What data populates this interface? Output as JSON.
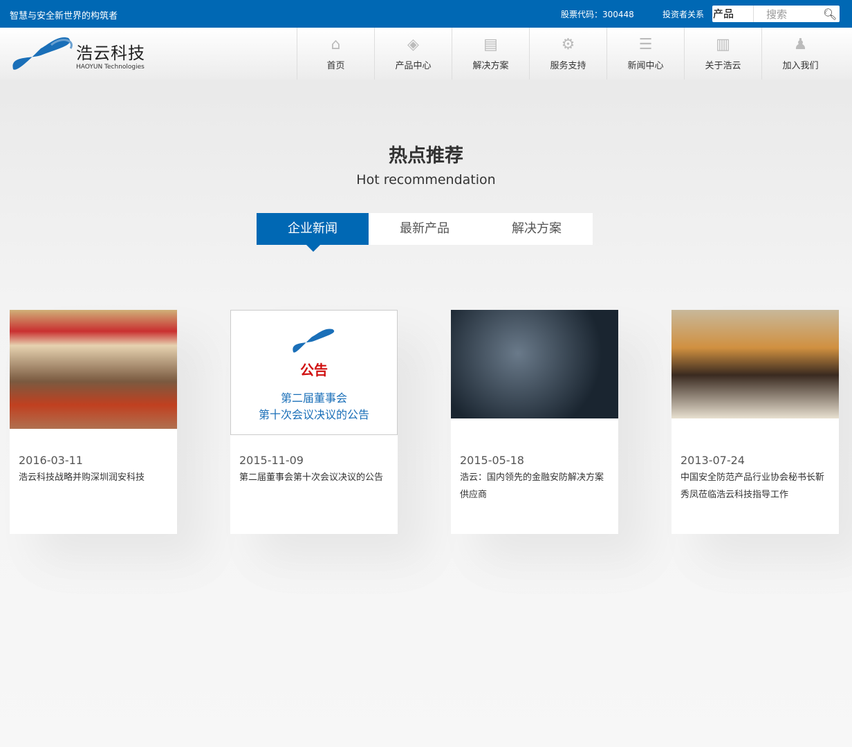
{
  "topbar": {
    "slogan": "智慧与安全新世界的构筑者",
    "stock": "股票代码：300448",
    "investor": "投资者关系",
    "search_category": "产品",
    "search_placeholder": "搜索"
  },
  "logo": {
    "cn": "浩云科技",
    "en": "HAOYUN Technologies"
  },
  "nav": [
    {
      "label": "首页",
      "icon": "home-icon"
    },
    {
      "label": "产品中心",
      "icon": "layers-icon"
    },
    {
      "label": "解决方案",
      "icon": "document-check-icon"
    },
    {
      "label": "服务支持",
      "icon": "gears-icon"
    },
    {
      "label": "新闻中心",
      "icon": "news-icon"
    },
    {
      "label": "关于浩云",
      "icon": "building-icon"
    },
    {
      "label": "加入我们",
      "icon": "user-icon"
    }
  ],
  "section": {
    "title": "热点推荐",
    "subtitle": "Hot recommendation"
  },
  "tabs": [
    "企业新闻",
    "最新产品",
    "解决方案"
  ],
  "cards": [
    {
      "date": "2016-03-11",
      "text": "浩云科技战略并购深圳润安科技"
    },
    {
      "date": "2015-11-09",
      "text": "第二届董事会第十次会议决议的公告",
      "img_title": "公告",
      "img_line1": "第二届董事会",
      "img_line2": "第十次会议决议的公告"
    },
    {
      "date": "2015-05-18",
      "text": "浩云：国内领先的金融安防解决方案供应商"
    },
    {
      "date": "2013-07-24",
      "text": "中国安全防范产品行业协会秘书长靳秀凤莅临浩云科技指导工作"
    }
  ]
}
